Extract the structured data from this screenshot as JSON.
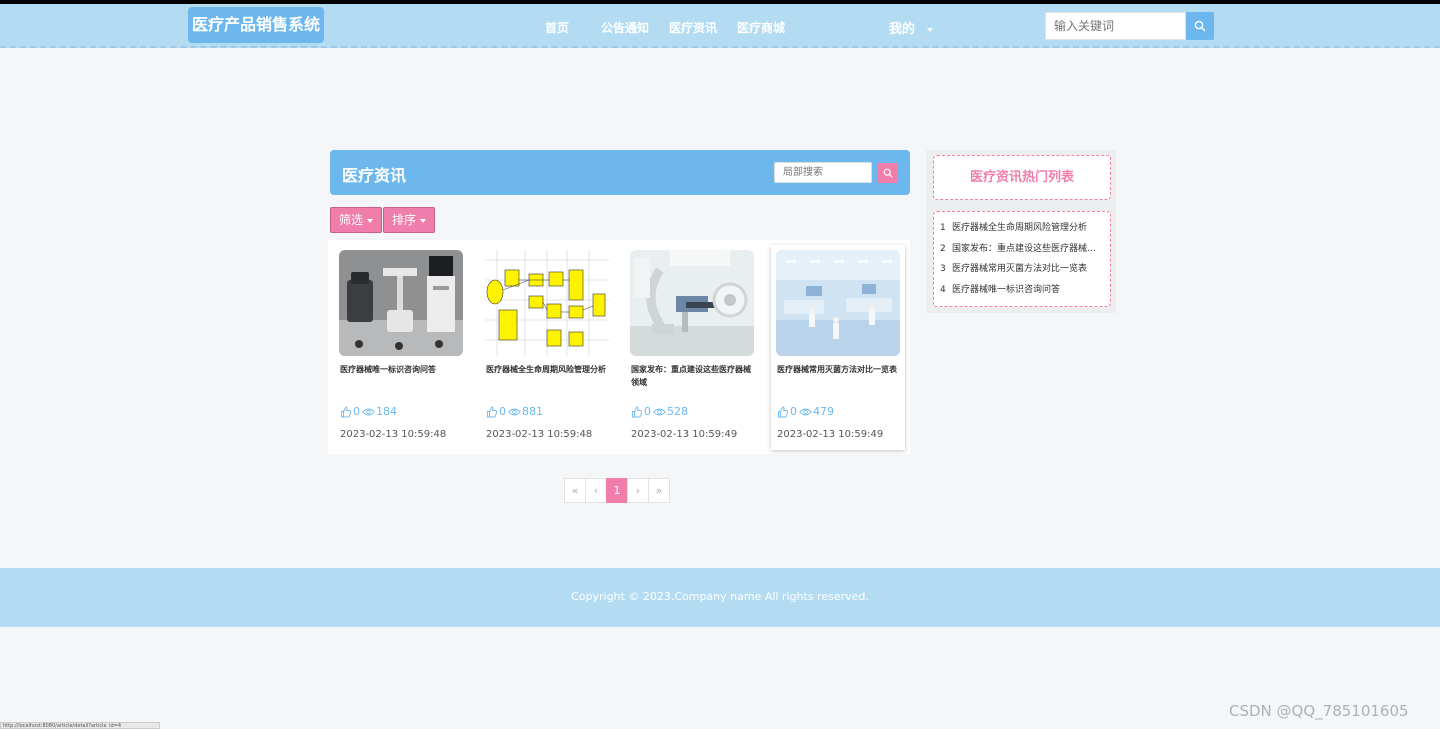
{
  "header": {
    "brand": "医疗产品销售系统",
    "nav": [
      "首页",
      "公告通知",
      "医疗资讯",
      "医疗商城"
    ],
    "mine": "我的",
    "search_placeholder": "输入关键词"
  },
  "panel": {
    "title": "医疗资讯",
    "search_placeholder": "局部搜索"
  },
  "filters": {
    "filter_label": "筛选",
    "sort_label": "排序"
  },
  "cards": [
    {
      "title": "医疗器械唯一标识咨询问答",
      "likes": "0",
      "views": "184",
      "date": "2023-02-13 10:59:48"
    },
    {
      "title": "医疗器械全生命周期风险管理分析",
      "likes": "0",
      "views": "881",
      "date": "2023-02-13 10:59:48"
    },
    {
      "title": "国家发布：重点建设这些医疗器械领域",
      "likes": "0",
      "views": "528",
      "date": "2023-02-13 10:59:49"
    },
    {
      "title": "医疗器械常用灭菌方法对比一览表",
      "likes": "0",
      "views": "479",
      "date": "2023-02-13 10:59:49"
    }
  ],
  "pager": {
    "first": "«",
    "prev": "‹",
    "current": "1",
    "next": "›",
    "last": "»"
  },
  "hot": {
    "title": "医疗资讯热门列表",
    "items": [
      {
        "num": "1",
        "text": "医疗器械全生命周期风险管理分析"
      },
      {
        "num": "2",
        "text": "国家发布：重点建设这些医疗器械领域"
      },
      {
        "num": "3",
        "text": "医疗器械常用灭菌方法对比一览表"
      },
      {
        "num": "4",
        "text": "医疗器械唯一标识咨询问答"
      }
    ]
  },
  "footer": {
    "copyright": "Copyright © 2023.Company name All rights reserved."
  },
  "statusbar": {
    "url": "http://localhost:8080/article/detail?article_id=4"
  },
  "watermark": "CSDN @QQ_785101605",
  "colors": {
    "header_bg": "#b3dcf2",
    "accent_blue": "#6cb8ee",
    "accent_pink": "#f07eaa"
  }
}
